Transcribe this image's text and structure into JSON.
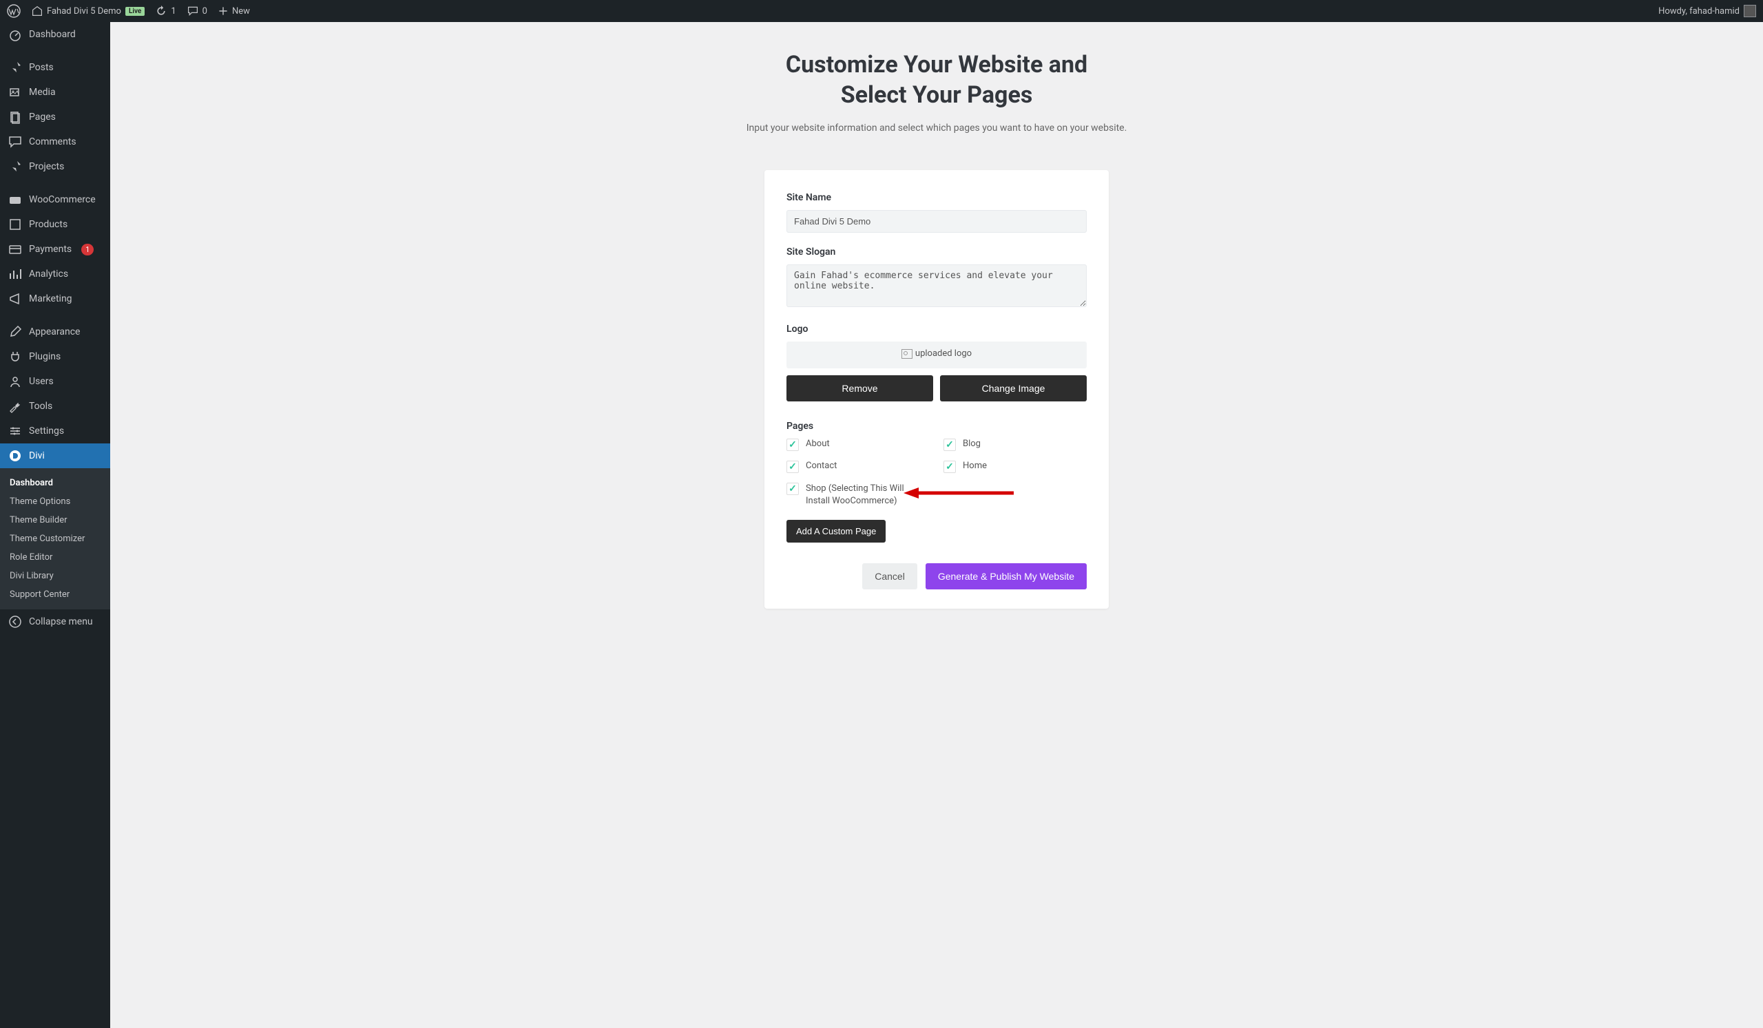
{
  "admin_bar": {
    "site_name": "Fahad Divi 5 Demo",
    "live_badge": "Live",
    "updates": "1",
    "comments": "0",
    "new_label": "New",
    "howdy": "Howdy, fahad-hamid"
  },
  "sidebar": {
    "items": [
      {
        "label": "Dashboard",
        "icon": "dashboard"
      },
      {
        "sep": true
      },
      {
        "label": "Posts",
        "icon": "pin"
      },
      {
        "label": "Media",
        "icon": "media"
      },
      {
        "label": "Pages",
        "icon": "pages"
      },
      {
        "label": "Comments",
        "icon": "comments"
      },
      {
        "label": "Projects",
        "icon": "pin"
      },
      {
        "sep": true
      },
      {
        "label": "WooCommerce",
        "icon": "woo"
      },
      {
        "label": "Products",
        "icon": "products"
      },
      {
        "label": "Payments",
        "icon": "payments",
        "badge": "1"
      },
      {
        "label": "Analytics",
        "icon": "analytics"
      },
      {
        "label": "Marketing",
        "icon": "marketing"
      },
      {
        "sep": true
      },
      {
        "label": "Appearance",
        "icon": "brush"
      },
      {
        "label": "Plugins",
        "icon": "plug"
      },
      {
        "label": "Users",
        "icon": "users"
      },
      {
        "label": "Tools",
        "icon": "wrench"
      },
      {
        "label": "Settings",
        "icon": "settings"
      },
      {
        "label": "Divi",
        "icon": "divi",
        "active": true
      }
    ],
    "divi_submenu": [
      "Dashboard",
      "Theme Options",
      "Theme Builder",
      "Theme Customizer",
      "Role Editor",
      "Divi Library",
      "Support Center"
    ],
    "divi_submenu_current": "Dashboard",
    "collapse": "Collapse menu"
  },
  "main": {
    "heading_line1": "Customize Your Website and",
    "heading_line2": "Select Your Pages",
    "subtitle": "Input your website information and select which pages you want to have on your website.",
    "site_name_label": "Site Name",
    "site_name_value": "Fahad Divi 5 Demo",
    "slogan_label": "Site Slogan",
    "slogan_value": "Gain Fahad's ecommerce services and elevate your online website.",
    "logo_label": "Logo",
    "logo_alt": "uploaded logo",
    "remove_btn": "Remove",
    "change_btn": "Change Image",
    "pages_label": "Pages",
    "pages": {
      "about": "About",
      "blog": "Blog",
      "contact": "Contact",
      "home": "Home",
      "shop": "Shop (Selecting This Will Install WooCommerce)"
    },
    "add_page_btn": "Add A Custom Page",
    "cancel_btn": "Cancel",
    "generate_btn": "Generate & Publish My Website"
  }
}
